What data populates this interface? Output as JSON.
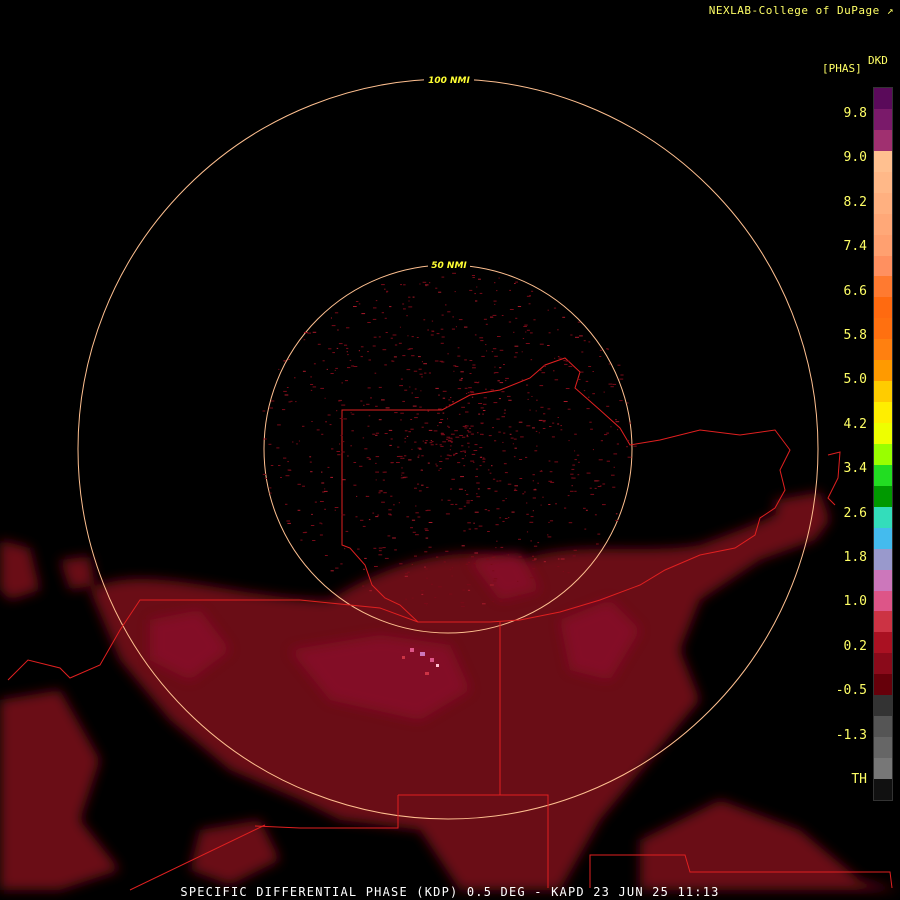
{
  "credit": "NEXLAB-College of DuPage",
  "legend": {
    "product": "DKD",
    "unit": "[PHAS]",
    "ticks": [
      "9.8",
      "9.0",
      "8.2",
      "7.4",
      "6.6",
      "5.8",
      "5.0",
      "4.2",
      "3.4",
      "2.6",
      "1.8",
      "1.0",
      "0.2",
      "-0.5",
      "-1.3",
      "TH"
    ],
    "colors": [
      "#5a0a5a",
      "#7a1a6a",
      "#a03070",
      "#ffc090",
      "#ffb888",
      "#ffb080",
      "#ffa878",
      "#ffa070",
      "#ff9060",
      "#ff7a30",
      "#ff6a10",
      "#ff7010",
      "#ff8010",
      "#ff9a00",
      "#ffcc00",
      "#ffee00",
      "#eeff00",
      "#99ff00",
      "#22dd22",
      "#009900",
      "#33ddbb",
      "#44bbee",
      "#9999cc",
      "#cc77bb",
      "#dd5588",
      "#cc3344",
      "#aa1122",
      "#8a0a1a",
      "#66000a",
      "#333333",
      "#555555",
      "#666666",
      "#777777",
      "#111111"
    ]
  },
  "rings": [
    {
      "label": "100 NMI"
    },
    {
      "label": "50 NMI"
    }
  ],
  "footer": "SPECIFIC DIFFERENTIAL PHASE (KDP) 0.5 DEG - KAPD 23 JUN 25 11:13"
}
